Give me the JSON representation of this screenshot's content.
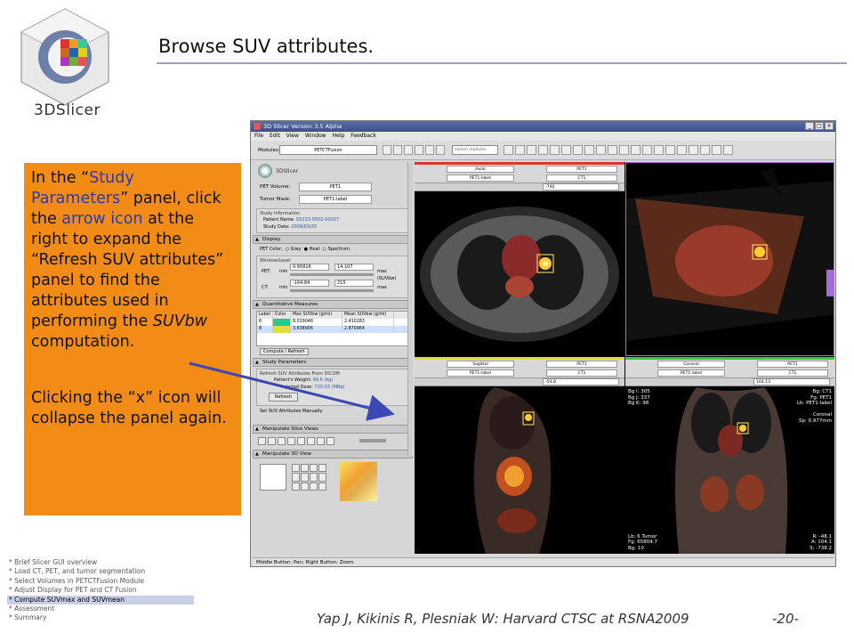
{
  "slide": {
    "title": "Browse SUV attributes.",
    "logo_text": "3DSlicer",
    "footer": "Yap J, Kikinis R, Plesniak W: Harvard CTSC at RSNA2009",
    "page_number": "-20-"
  },
  "callout": {
    "p1_a": "In the “",
    "p1_b": "Study Parameters",
    "p1_c": "” panel, click the ",
    "p1_d": "arrow icon",
    "p1_e": " at the right to expand the “Refresh SUV attributes” panel to find the attributes used in performing the ",
    "p1_f": "SUVbw",
    "p1_g": " computation.",
    "p2": "Clicking the “x” icon will collapse the panel again."
  },
  "toc": {
    "items": [
      "* Brief Slicer GUI overview",
      "* Load CT, PET, and tumor segmentation",
      "* Select Volumes in PETCTFusion Module",
      "* Adjust Display for PET and CT Fusion",
      "* Compute SUVmax and SUVmean",
      "* Assessment",
      "* Summary"
    ],
    "active_index": 4
  },
  "app": {
    "window_title": "3D Slicer Version 3.5 Alpha",
    "menu": [
      "File",
      "Edit",
      "View",
      "Window",
      "Help",
      "Feedback"
    ],
    "toolbar": {
      "modules_label": "Modules:",
      "module_value": "PETCTFusion",
      "search_placeholder": "search modules"
    },
    "panel": {
      "logo_text": "3DSlicer",
      "pet_volume_label": "PET Volume:",
      "pet_volume_value": "PET1",
      "tumor_mask_label": "Tumor Mask:",
      "tumor_mask_value": "PET1-label",
      "study_info_title": "Study Information",
      "patient_name_label": "Patient Name:",
      "patient_name_value": "05223-0502-00027",
      "study_date_label": "Study Date:",
      "study_date_value": "2009/03/20",
      "display_header": "Display",
      "pet_color_label": "PET Color:",
      "pet_color_options": [
        "Grey",
        "Heat",
        "Spectrum"
      ],
      "window_level_title": "Window/Level",
      "pet_label": "PET:",
      "min_label": "min",
      "max_suv_label": "max (SUVbw)",
      "pet_min": "0.95816",
      "pet_max": "14.107",
      "ct_label": "CT:",
      "max_label": "max",
      "ct_min": "-164.84",
      "ct_max": "215",
      "quant_header": "Quantitative Measures",
      "table_headers": [
        "Label",
        "Color",
        "Max SUVbw (g/ml)",
        "Mean SUVbw (g/ml)"
      ],
      "table_rows": [
        [
          "6",
          "",
          "8.019048",
          "2.410283"
        ],
        [
          "8",
          "",
          "3.638906",
          "2.870964"
        ]
      ],
      "compute_button": "Compute / Refresh",
      "study_params_header": "Study Parameters",
      "refresh_suv_title": "Refresh SUV Attributes From DICOM",
      "patient_weight_label": "Patient's Weight:",
      "patient_weight_value": "60.6 (kg)",
      "injected_dose_label": "Injected Dose:",
      "injected_dose_value": "710.03 (MBq)",
      "refresh_button": "Refresh",
      "set_suv_manual": "Set SUV Attributes Manually",
      "manip_slice_header": "Manipulate Slice Views",
      "manip_3d_header": "Manipulate 3D View"
    },
    "viewers": {
      "red": {
        "orientation": "Axial",
        "fg": "PET1",
        "label": "PET1-label",
        "bg": "CT1",
        "offset": "-740"
      },
      "yellow": {
        "orientation": "Sagittal",
        "fg": "PET1",
        "label": "PET1-label",
        "bg": "CT1",
        "offset": "-54.8"
      },
      "green": {
        "orientation": "Coronal",
        "fg": "PET1",
        "label": "PET1-label",
        "bg": "CT1",
        "offset": "104.13"
      },
      "coronal_overlay": {
        "tl": [
          "Bg I: 305",
          "Bg J: 337",
          "Bg K: 98"
        ],
        "tr": [
          "Bg: CT1",
          "Fg: PET1",
          "Lb: PET1-label"
        ],
        "mr": [
          "Coronal",
          "Sp: 0.977mm"
        ],
        "bl": [
          "Lb: 6 Tumor",
          "Fg: 65804.7",
          "Bg: 10"
        ],
        "br": [
          "R: -48.1",
          "A: 104.1",
          "S: -738.2"
        ]
      }
    },
    "status": "Middle Button: Pan; Right Button: Zoom"
  },
  "colors": {
    "callout_bg": "#f28c16",
    "highlight_text": "#2b3aa6",
    "arrow": "#3b47b3",
    "title_rule": "#9aa0c8"
  }
}
